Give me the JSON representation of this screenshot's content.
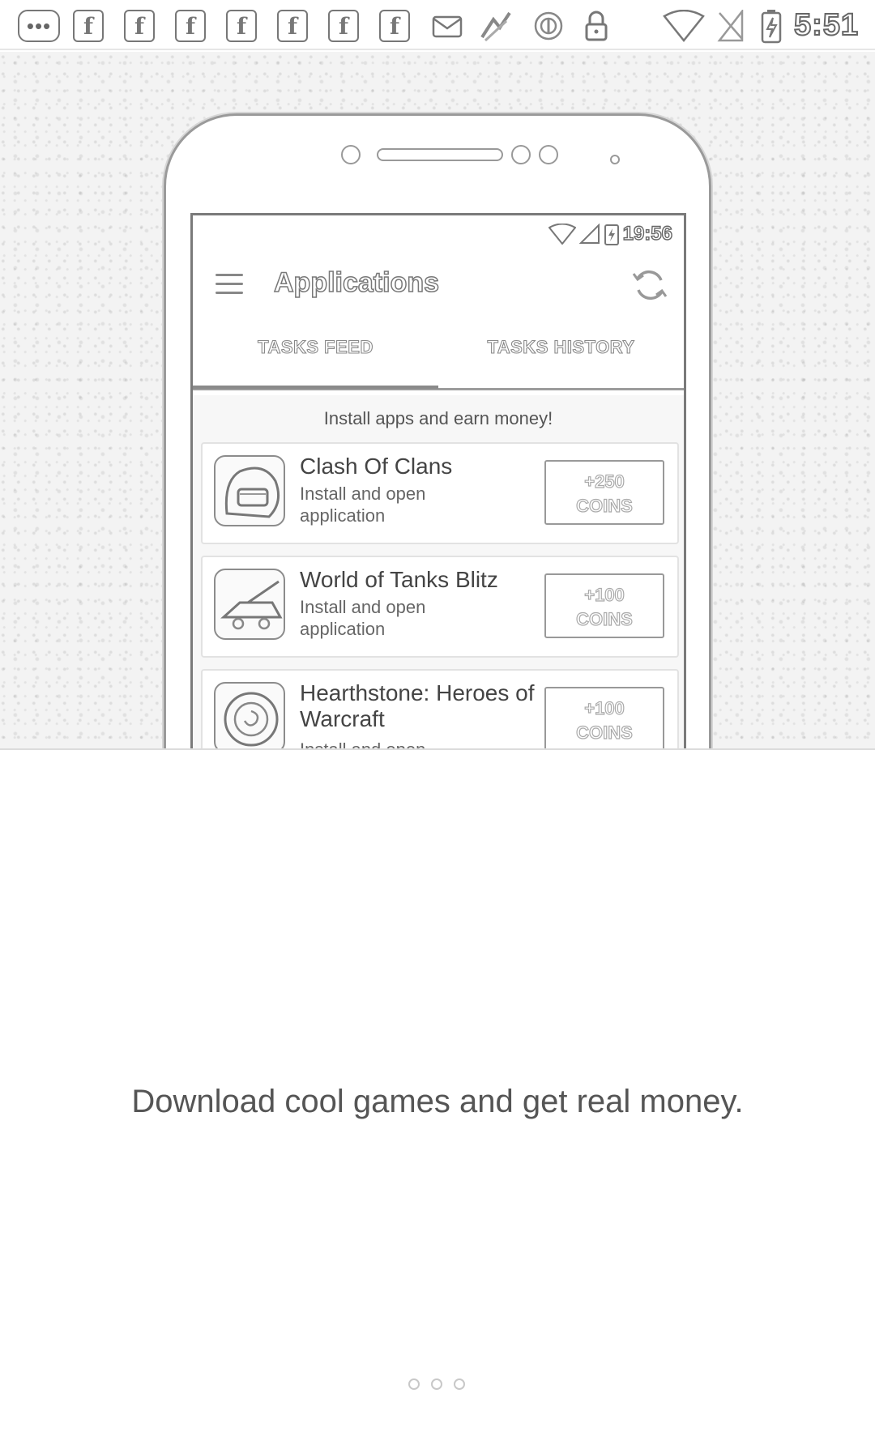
{
  "status_bar": {
    "time": "5:51",
    "notification_icons": [
      "more-icon",
      "facebook-icon",
      "facebook-icon",
      "facebook-icon",
      "facebook-icon",
      "facebook-icon",
      "facebook-icon",
      "facebook-icon",
      "mail-icon",
      "app-icon",
      "sync-icon",
      "lock-icon"
    ],
    "system_icons": [
      "wifi-icon",
      "no-sim-icon",
      "battery-charging-icon"
    ]
  },
  "mockup": {
    "status_time": "19:56",
    "app_title": "Applications",
    "tabs": [
      {
        "label": "TASKS FEED",
        "active": true
      },
      {
        "label": "TASKS HISTORY",
        "active": false
      }
    ],
    "caption": "Install apps and earn money!",
    "tasks": [
      {
        "title": "Clash Of Clans",
        "subtitle": "Install and open application",
        "reward": "+250",
        "reward_unit": "COINS"
      },
      {
        "title": "World of Tanks Blitz",
        "subtitle": "Install and open application",
        "reward": "+100",
        "reward_unit": "COINS"
      },
      {
        "title": "Hearthstone: Heroes of Warcraft",
        "subtitle": "Install and open",
        "reward": "+100",
        "reward_unit": "COINS"
      }
    ]
  },
  "tagline": "Download cool games and get real money.",
  "pager": {
    "pages": 3,
    "current": 1
  }
}
